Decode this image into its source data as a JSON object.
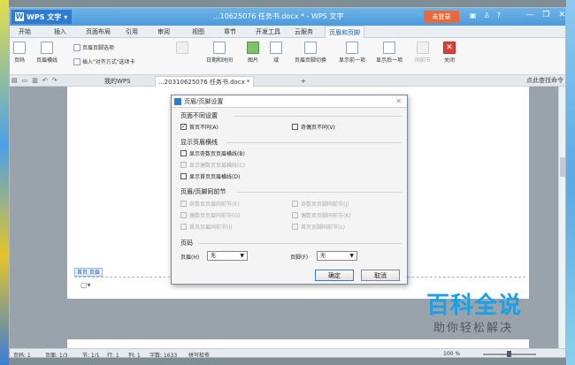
{
  "app": {
    "name": "WPS 文字",
    "title": "...10625076 任务书.docx * - WPS 文字",
    "login": "未登录",
    "window_controls": [
      "—",
      "❐",
      "✕"
    ]
  },
  "menu_tabs": [
    "开始",
    "插入",
    "页面布局",
    "引用",
    "审阅",
    "视图",
    "章节",
    "开发工具",
    "云服务",
    "页眉和页脚"
  ],
  "ribbon": {
    "page_num": "页码",
    "header_line": "页眉横线",
    "header_options": "页眉页脚选项",
    "insert_align": "插入\"对齐方式\"选项卡",
    "date_time": "日期和时间",
    "picture": "图片",
    "field": "域",
    "switch": "页眉页脚切换",
    "show_prev": "显示前一项",
    "show_next": "显示后一项",
    "same_prev": "同前节",
    "close": "关闭"
  },
  "doc_tabs": {
    "my_wps": "我的WPS",
    "doc": "...20310625076 任务书.docx *",
    "search_cmd": "点此查找命令"
  },
  "page": {
    "header_label": "首页 页眉"
  },
  "dialog": {
    "title": "页眉/页脚设置",
    "close": "✕",
    "sec_diff": "页面不同设置",
    "first_page_diff": "首页不同(A)",
    "odd_even_diff": "奇偶页不同(V)",
    "sec_header_line": "显示页眉横线",
    "odd_header_line": "显示奇数页页眉横线(B)",
    "even_header_line": "显示偶数页页眉横线(C)",
    "first_header_line": "显示首页页眉横线(D)",
    "sec_same_prev": "页眉/页脚同前节",
    "odd_header_prev": "奇数页页眉同前节(E)",
    "odd_footer_prev": "奇数页页脚同前节(J)",
    "even_header_prev": "偶数页页眉同前节(G)",
    "even_footer_prev": "偶数页页脚同前节(K)",
    "first_header_prev": "首页页眉同前节(I)",
    "first_footer_prev": "首页页脚同前节(L)",
    "sec_page_num": "页码",
    "header_label": "页眉(H)",
    "header_value": "无",
    "footer_label": "页脚(F)",
    "footer_value": "无",
    "ok": "确定",
    "cancel": "取消"
  },
  "statusbar": {
    "page_num": "页码: 1",
    "page": "页面: 1/3",
    "section": "节: 1/1",
    "row": "行: 1",
    "col": "列: 1",
    "words": "字数: 1633",
    "spell": "拼写检查",
    "zoom": "100 %"
  },
  "watermark": {
    "main": "百科全说",
    "sub": "助你轻松解决"
  }
}
